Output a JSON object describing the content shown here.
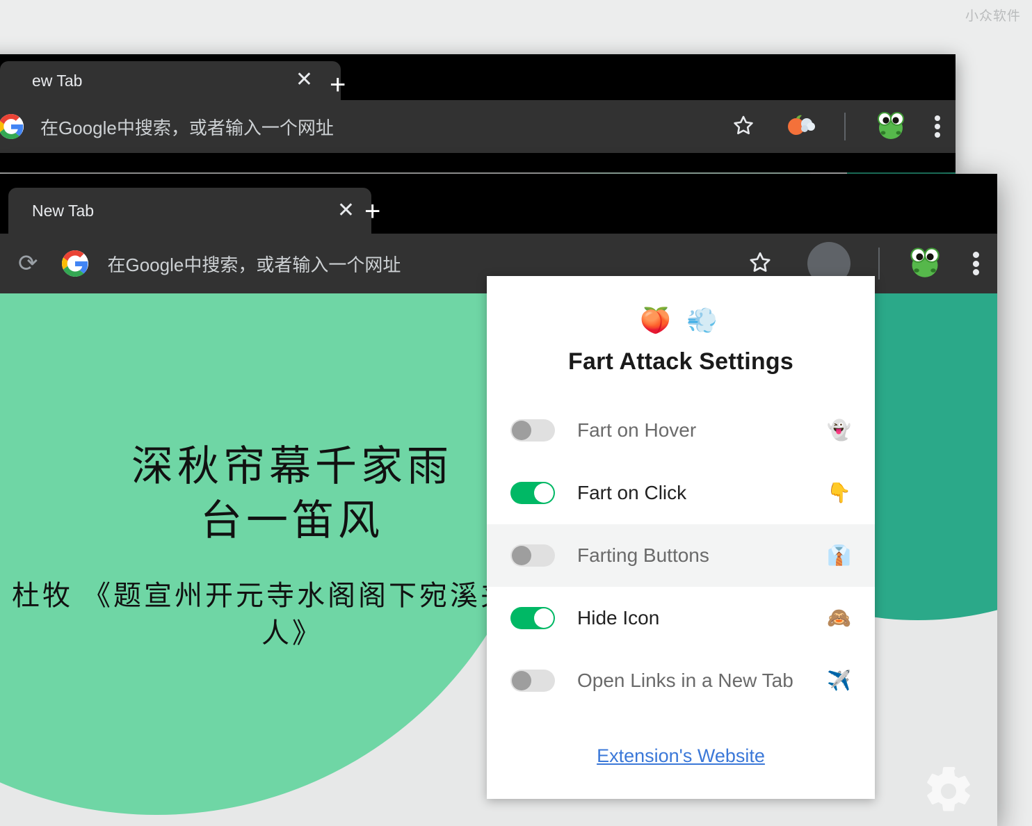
{
  "watermark": "小众软件",
  "back_window": {
    "tab": {
      "title": "ew Tab",
      "close_icon": "close-icon"
    },
    "new_tab_button": "+",
    "omnibox": {
      "placeholder": "在Google中搜索，或者输入一个网址",
      "search_engine_icon": "google-g-icon"
    },
    "toolbar_icons": {
      "bookmark": "star-icon",
      "extension": "peach-fart-extension-icon",
      "profile": "frog-avatar-icon",
      "menu": "three-dot-menu-icon"
    }
  },
  "front_window": {
    "tab": {
      "title": "New Tab",
      "close_icon": "close-icon"
    },
    "new_tab_button": "+",
    "reload_icon": "reload-icon",
    "omnibox": {
      "placeholder": "在Google中搜索，或者输入一个网址",
      "search_engine_icon": "google-g-icon"
    },
    "toolbar_icons": {
      "bookmark": "star-icon",
      "profile_placeholder": "grey-avatar-circle",
      "profile": "frog-avatar-icon",
      "menu": "three-dot-menu-icon"
    },
    "page": {
      "poem_line_1": "深秋帘幕千家雨",
      "poem_line_2": "台一笛风",
      "poem_cite_1": "杜牧 《题宣州开元寺水阁阁下宛溪夹溪居",
      "poem_cite_2": "人》",
      "gear_icon": "gear-icon",
      "colors": {
        "background": "#e7e8e8",
        "green_blob": "#6fd6a5",
        "teal_blob": "#2ba989"
      }
    }
  },
  "popup": {
    "logo_emoji": "🍑 💨",
    "logo_icon_names": [
      "peach-icon",
      "dash-wind-icon"
    ],
    "title": "Fart Attack Settings",
    "options": [
      {
        "label": "Fart on Hover",
        "enabled": false,
        "hovered": false,
        "emoji": "👻",
        "icon_name": "ghost-icon"
      },
      {
        "label": "Fart on Click",
        "enabled": true,
        "hovered": false,
        "emoji": "👇",
        "icon_name": "point-down-icon"
      },
      {
        "label": "Farting Buttons",
        "enabled": false,
        "hovered": true,
        "emoji": "👔",
        "icon_name": "necktie-icon"
      },
      {
        "label": "Hide Icon",
        "enabled": true,
        "hovered": false,
        "emoji": "🙈",
        "icon_name": "see-no-evil-monkey-icon"
      },
      {
        "label": "Open Links in a New Tab",
        "enabled": false,
        "hovered": false,
        "emoji": "✈️",
        "icon_name": "airplane-icon"
      }
    ],
    "footer_link": "Extension's Website",
    "colors": {
      "toggle_on": "#00b865",
      "toggle_off_track": "#e0e0e0",
      "toggle_off_knob": "#9e9e9e",
      "link": "#3b78d8",
      "hover_row": "#f3f4f4"
    }
  }
}
